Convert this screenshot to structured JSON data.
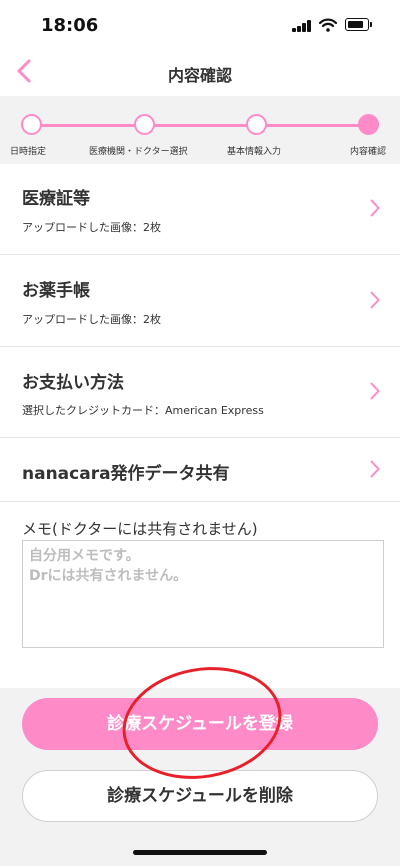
{
  "status_bar": {
    "time": "18:06"
  },
  "nav": {
    "title": "内容確認"
  },
  "steps": [
    {
      "label": "日時指定",
      "state": "done"
    },
    {
      "label": "医療機関・ドクター選択",
      "state": "done"
    },
    {
      "label": "基本情報入力",
      "state": "done"
    },
    {
      "label": "内容確認",
      "state": "current"
    }
  ],
  "rows": [
    {
      "title": "医療証等",
      "subtitle": "アップロードした画像：2枚"
    },
    {
      "title": "お薬手帳",
      "subtitle": "アップロードした画像：2枚"
    },
    {
      "title": "お支払い方法",
      "subtitle": "選択したクレジットカード：American Express"
    },
    {
      "title": "nanacara発作データ共有"
    }
  ],
  "memo": {
    "label": "メモ(ドクターには共有されません)",
    "value": "",
    "placeholder": "自分用メモです。\nDrには共有されません。"
  },
  "buttons": {
    "register": "診療スケジュールを登録",
    "delete": "診療スケジュールを削除"
  },
  "colors": {
    "accent": "#ff8ac8",
    "annotation": "#e8202a",
    "footer_bg": "#f2f2f2"
  }
}
